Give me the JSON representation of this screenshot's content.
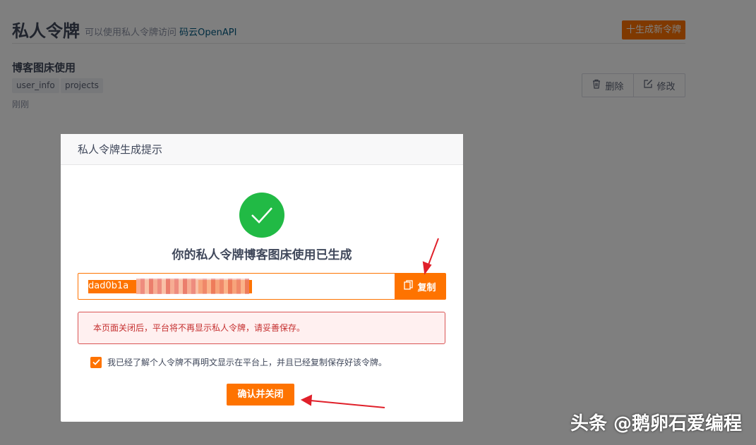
{
  "page": {
    "title": "私人令牌",
    "subtitle_prefix": "可以使用私人令牌访问",
    "subtitle_link": "码云OpenAPI",
    "new_token_button": "十生成新令牌"
  },
  "token_card": {
    "name": "博客图床使用",
    "scopes": [
      "user_info",
      "projects"
    ],
    "time": "刚刚",
    "delete_label": "删除",
    "edit_label": "修改"
  },
  "modal": {
    "title": "私人令牌生成提示",
    "heading": "你的私人令牌博客图床使用已生成",
    "token_value": "dad0b1a",
    "copy_label": "复制",
    "warning": "本页面关闭后，平台将不再显示私人令牌，请妥善保存。",
    "agree_text": "我已经了解个人令牌不再明文显示在平台上，并且已经复制保存好该令牌。",
    "agree_checked": true,
    "confirm_label": "确认并关闭"
  },
  "watermark": "头条 @鹅卵石爱编程",
  "colors": {
    "accent": "#fe7300",
    "success": "#21ba45",
    "danger": "#d95555",
    "annotation_arrow": "#e0202a"
  }
}
